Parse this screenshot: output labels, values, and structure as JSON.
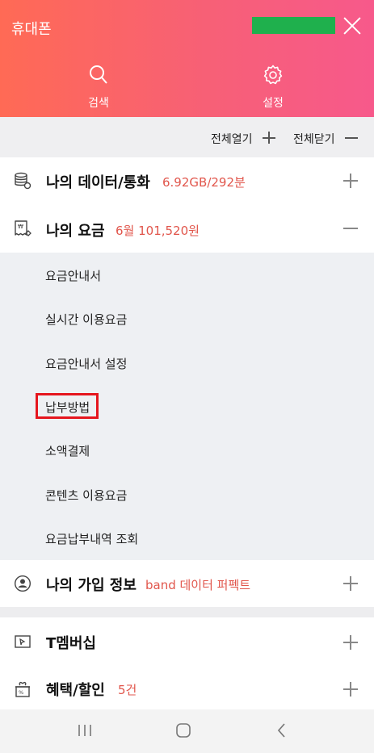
{
  "header": {
    "title": "휴대폰",
    "search_label": "검색",
    "settings_label": "설정",
    "accent_gradient": [
      "#ff6a55",
      "#f7598b"
    ],
    "redaction_color": "#1fb04d"
  },
  "controls": {
    "expand_all": "전체열기",
    "collapse_all": "전체닫기"
  },
  "sections": [
    {
      "title": "나의 데이터/통화",
      "info": "6.92GB/292분",
      "icon": "database-icon",
      "state": "collapsed"
    },
    {
      "title": "나의 요금",
      "info": "6월 101,520원",
      "icon": "receipt-icon",
      "state": "expanded"
    },
    {
      "title": "나의 가입 정보",
      "info": "band 데이터 퍼펙트",
      "icon": "user-circle-icon",
      "state": "collapsed"
    },
    {
      "title": "T멤버십",
      "info": "",
      "icon": "membership-card-icon",
      "state": "collapsed"
    },
    {
      "title": "혜택/할인",
      "info": "5건",
      "icon": "gift-icon",
      "state": "collapsed"
    }
  ],
  "billing_menu": [
    "요금안내서",
    "실시간 이용요금",
    "요금안내서 설정",
    "납부방법",
    "소액결제",
    "콘텐츠 이용요금",
    "요금납부내역 조회"
  ],
  "highlighted_item": "납부방법",
  "colors": {
    "info_text": "#e1564c",
    "highlight_border": "#e5151d"
  }
}
